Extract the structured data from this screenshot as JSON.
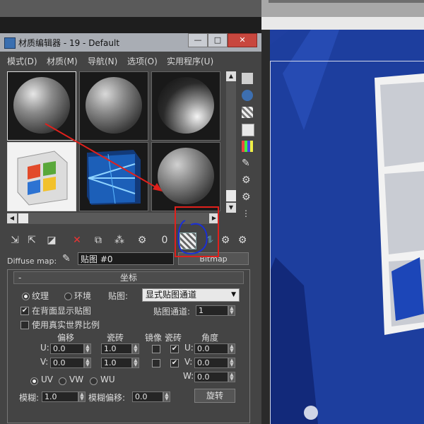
{
  "window": {
    "title": "材质编辑器 - 19 - Default",
    "minimize": "—",
    "maximize": "□",
    "close": "✕"
  },
  "menu": [
    "模式(D)",
    "材质(M)",
    "导航(N)",
    "选项(O)",
    "实用程序(U)"
  ],
  "diffuse": {
    "label": "Diffuse map:",
    "map_name": "贴图 #0",
    "map_type": "Bitmap"
  },
  "rollout": {
    "title": "坐标",
    "collapse": "-",
    "texture_radio": "纹理",
    "environ_radio": "环境",
    "mapping_label": "贴图:",
    "mapping_value": "显式贴图通道",
    "channel_label": "贴图通道:",
    "channel_value": "1",
    "show_back": "在背面显示贴图",
    "real_world": "使用真实世界比例",
    "col_offset": "偏移",
    "col_tiling": "瓷砖",
    "col_mirror": "镜像",
    "col_tile2": "瓷砖",
    "col_angle": "角度",
    "u_label": "U:",
    "v_label": "V:",
    "w_label": "W:",
    "u_offset": "0.0",
    "v_offset": "0.0",
    "u_tiling": "1.0",
    "v_tiling": "1.0",
    "u_angle": "0.0",
    "v_angle": "0.0",
    "w_angle": "0.0",
    "uv": "UV",
    "vw": "VW",
    "wu": "WU",
    "blur_label": "模糊:",
    "blur_value": "1.0",
    "blur_offset_label": "模糊偏移:",
    "blur_offset_value": "0.0",
    "rotate_button": "旋转"
  },
  "colors": {
    "annotation_red": "#e0201c",
    "annotation_blue": "#1a2fd6",
    "viewport_blue": "#1f3fa0"
  }
}
